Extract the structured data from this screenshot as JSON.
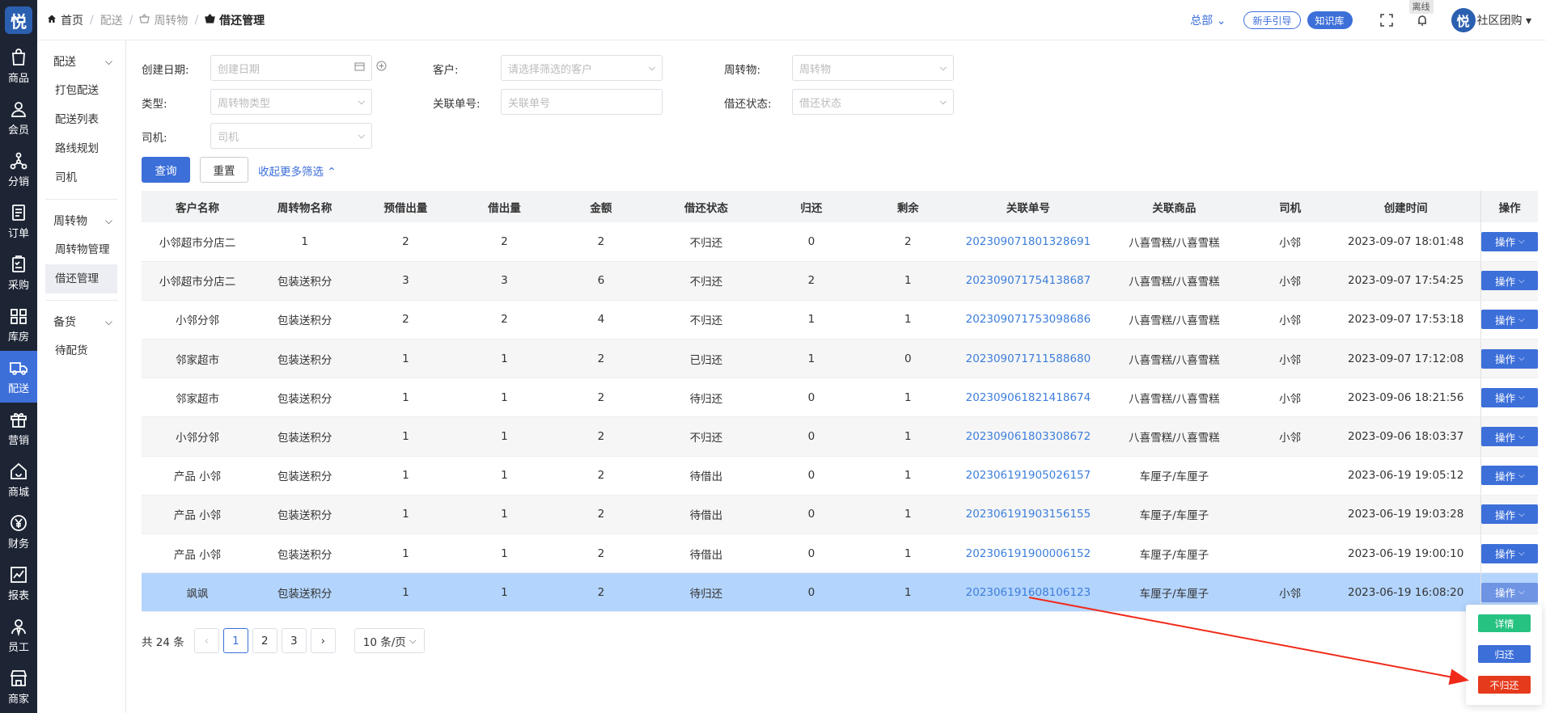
{
  "brand": {
    "logo_char": "悦"
  },
  "rail": [
    {
      "label": "商品",
      "icon": "bag-icon"
    },
    {
      "label": "会员",
      "icon": "user-icon"
    },
    {
      "label": "分销",
      "icon": "network-icon"
    },
    {
      "label": "订单",
      "icon": "order-icon"
    },
    {
      "label": "采购",
      "icon": "clipboard-icon"
    },
    {
      "label": "库房",
      "icon": "warehouse-icon"
    },
    {
      "label": "配送",
      "icon": "truck-icon"
    },
    {
      "label": "营销",
      "icon": "gift-icon"
    },
    {
      "label": "商城",
      "icon": "home-icon"
    },
    {
      "label": "财务",
      "icon": "yen-icon"
    },
    {
      "label": "报表",
      "icon": "chart-icon"
    },
    {
      "label": "员工",
      "icon": "staff-icon"
    },
    {
      "label": "商家",
      "icon": "shop-icon"
    }
  ],
  "subnav": {
    "groups": [
      {
        "title": "配送",
        "items": [
          "打包配送",
          "配送列表",
          "路线规划",
          "司机"
        ]
      },
      {
        "title": "周转物",
        "items": [
          "周转物管理",
          "借还管理"
        ]
      },
      {
        "title": "备货",
        "items": [
          "待配货"
        ]
      }
    ]
  },
  "breadcrumb": {
    "home": "首页",
    "b1": "配送",
    "b2": "周转物",
    "current": "借还管理"
  },
  "topbar": {
    "hq": "总部",
    "guide": "新手引导",
    "kb": "知识库",
    "offline": "离线",
    "team": "社区团购"
  },
  "filters": {
    "created_label": "创建日期:",
    "created_ph": "创建日期",
    "customer_label": "客户:",
    "customer_ph": "请选择筛选的客户",
    "item_label": "周转物:",
    "item_ph": "周转物",
    "type_label": "类型:",
    "type_ph": "周转物类型",
    "ref_label": "关联单号:",
    "ref_ph": "关联单号",
    "status_label": "借还状态:",
    "status_ph": "借还状态",
    "driver_label": "司机:",
    "driver_ph": "司机",
    "query": "查询",
    "reset": "重置",
    "collapse": "收起更多筛选"
  },
  "table": {
    "headers": [
      "客户名称",
      "周转物名称",
      "预借出量",
      "借出量",
      "金额",
      "借还状态",
      "归还",
      "剩余",
      "关联单号",
      "关联商品",
      "司机",
      "创建时间",
      "操作"
    ],
    "op_label": "操作",
    "rows": [
      [
        "小邻超市分店二",
        "1",
        "2",
        "2",
        "2",
        "不归还",
        "0",
        "2",
        "202309071801328691",
        "八喜雪糕/八喜雪糕",
        "小邻",
        "2023-09-07 18:01:48"
      ],
      [
        "小邻超市分店二",
        "包装送积分",
        "3",
        "3",
        "6",
        "不归还",
        "2",
        "1",
        "202309071754138687",
        "八喜雪糕/八喜雪糕",
        "小邻",
        "2023-09-07 17:54:25"
      ],
      [
        "小邻分邻",
        "包装送积分",
        "2",
        "2",
        "4",
        "不归还",
        "1",
        "1",
        "202309071753098686",
        "八喜雪糕/八喜雪糕",
        "小邻",
        "2023-09-07 17:53:18"
      ],
      [
        "邻家超市",
        "包装送积分",
        "1",
        "1",
        "2",
        "已归还",
        "1",
        "0",
        "202309071711588680",
        "八喜雪糕/八喜雪糕",
        "小邻",
        "2023-09-07 17:12:08"
      ],
      [
        "邻家超市",
        "包装送积分",
        "1",
        "1",
        "2",
        "待归还",
        "0",
        "1",
        "202309061821418674",
        "八喜雪糕/八喜雪糕",
        "小邻",
        "2023-09-06 18:21:56"
      ],
      [
        "小邻分邻",
        "包装送积分",
        "1",
        "1",
        "2",
        "不归还",
        "0",
        "1",
        "202309061803308672",
        "八喜雪糕/八喜雪糕",
        "小邻",
        "2023-09-06 18:03:37"
      ],
      [
        "产品 小邻",
        "包装送积分",
        "1",
        "1",
        "2",
        "待借出",
        "0",
        "1",
        "202306191905026157",
        "车厘子/车厘子",
        "",
        "2023-06-19 19:05:12"
      ],
      [
        "产品 小邻",
        "包装送积分",
        "1",
        "1",
        "2",
        "待借出",
        "0",
        "1",
        "202306191903156155",
        "车厘子/车厘子",
        "",
        "2023-06-19 19:03:28"
      ],
      [
        "产品 小邻",
        "包装送积分",
        "1",
        "1",
        "2",
        "待借出",
        "0",
        "1",
        "202306191900006152",
        "车厘子/车厘子",
        "",
        "2023-06-19 19:00:10"
      ],
      [
        "飒飒",
        "包装送积分",
        "1",
        "1",
        "2",
        "待归还",
        "0",
        "1",
        "202306191608106123",
        "车厘子/车厘子",
        "小邻",
        "2023-06-19 16:08:20"
      ]
    ]
  },
  "pagination": {
    "total": "共 24 条",
    "pages": [
      "1",
      "2",
      "3"
    ],
    "size": "10 条/页"
  },
  "popup": {
    "detail": "详情",
    "return": "归还",
    "no_return": "不归还"
  },
  "colors": {
    "primary": "#3d6fd9",
    "success": "#26c281",
    "danger": "#e53a1c",
    "link": "#3d7edb"
  }
}
